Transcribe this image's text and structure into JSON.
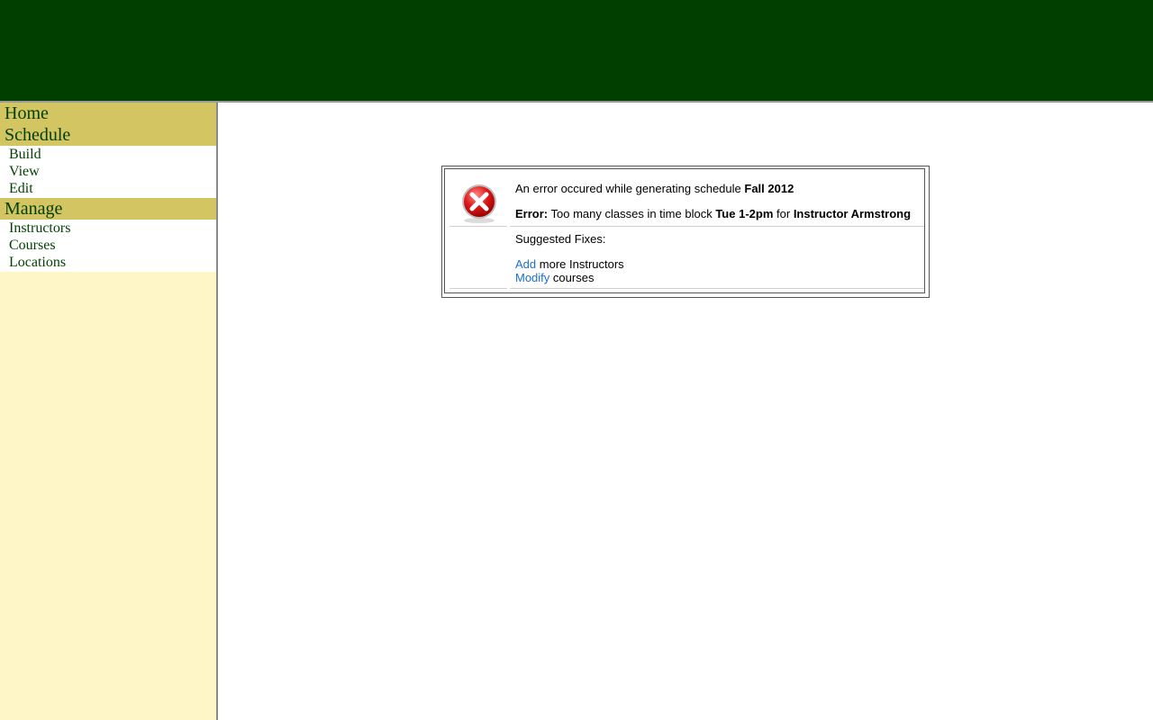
{
  "sidebar": {
    "sections": [
      {
        "label": "Home",
        "items": []
      },
      {
        "label": "Schedule",
        "items": [
          {
            "label": "Build"
          },
          {
            "label": "View"
          },
          {
            "label": "Edit"
          }
        ]
      },
      {
        "label": "Manage",
        "items": [
          {
            "label": "Instructors"
          },
          {
            "label": "Courses"
          },
          {
            "label": "Locations"
          }
        ]
      }
    ]
  },
  "error": {
    "icon": "error-x-icon",
    "intro": "An error occured while generating schedule",
    "schedule": "Fall 2012",
    "error_label": "Error:",
    "error_text_a": "Too many classes in time block",
    "time_block": "Tue 1-2pm",
    "error_text_b": "for",
    "instructor": "Instructor Armstrong",
    "suggested_title": "Suggested Fixes:",
    "fix1_link": "Add",
    "fix1_text": "more Instructors",
    "fix2_link": "Modify",
    "fix2_text": "courses"
  },
  "colors": {
    "header": "#003f00",
    "section_bg": "#d4c563",
    "sidebar_bg": "#fff6c8",
    "link": "#1a6fd0"
  }
}
